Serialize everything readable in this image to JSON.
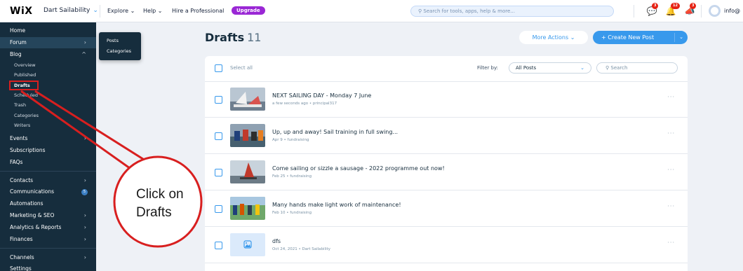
{
  "topbar": {
    "logo": "WiX",
    "site_name": "Dart Sailability",
    "nav": [
      "Explore",
      "Help",
      "Hire a Professional"
    ],
    "upgrade_label": "Upgrade",
    "search_placeholder": "Search for tools, apps, help & more...",
    "badges": [
      "3",
      "12",
      "3"
    ],
    "account": "info@"
  },
  "sidebar": {
    "home": "Home",
    "forum": "Forum",
    "blog": "Blog",
    "blog_sub": [
      "Overview",
      "Published",
      "Drafts",
      "Scheduled",
      "Trash",
      "Categories",
      "Writers"
    ],
    "events": "Events",
    "subscriptions": "Subscriptions",
    "faqs": "FAQs",
    "contacts": "Contacts",
    "communications": "Communications",
    "communications_badge": "5",
    "automations": "Automations",
    "marketing": "Marketing & SEO",
    "analytics": "Analytics & Reports",
    "finances": "Finances",
    "channels": "Channels",
    "settings": "Settings"
  },
  "flyout": {
    "items": [
      "Posts",
      "Categories"
    ]
  },
  "main": {
    "title": "Drafts",
    "count": "11",
    "more_actions": "More Actions",
    "create_post": "+ Create New Post",
    "select_all": "Select all",
    "filter_by": "Filter by:",
    "filter_value": "All Posts",
    "search_placeholder": "Search",
    "posts": [
      {
        "title": "NEXT SAILING DAY - Monday 7 June",
        "meta": "a few seconds ago • principal317"
      },
      {
        "title": "Up, up and away! Sail training in full swing...",
        "meta": "Apr 9 • fundraising"
      },
      {
        "title": "Come sailing or sizzle a sausage - 2022 programme out now!",
        "meta": "Feb 25 • fundraising"
      },
      {
        "title": "Many hands make light work of maintenance!",
        "meta": "Feb 10 • fundraising"
      },
      {
        "title": "dfs",
        "meta": "Oct 24, 2021 • Dart Sailability"
      }
    ]
  },
  "annotation": {
    "line1": "Click on",
    "line2": "Drafts",
    "color": "#d81f1f"
  }
}
